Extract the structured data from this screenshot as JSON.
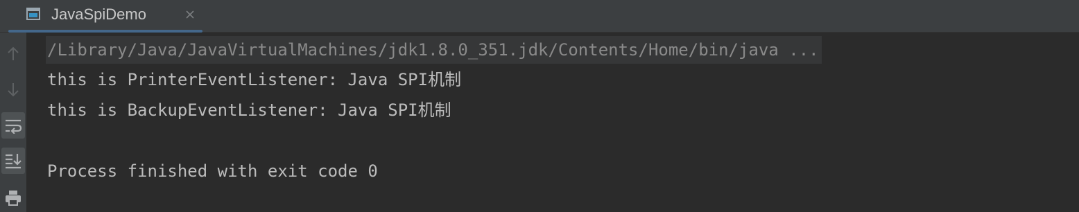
{
  "tab": {
    "title": "JavaSpiDemo",
    "icon": "console-window-icon",
    "close_icon": "close-icon"
  },
  "toolbar": {
    "buttons": [
      {
        "icon": "arrow-up-icon",
        "label": "Up the stack trace"
      },
      {
        "icon": "arrow-down-icon",
        "label": "Down the stack trace"
      },
      {
        "icon": "soft-wrap-icon",
        "label": "Soft-wrap",
        "active": true
      },
      {
        "icon": "scroll-to-end-icon",
        "label": "Scroll to the end",
        "active": true
      },
      {
        "icon": "print-icon",
        "label": "Print"
      }
    ]
  },
  "console": {
    "command_line": "/Library/Java/JavaVirtualMachines/jdk1.8.0_351.jdk/Contents/Home/bin/java ...",
    "output": [
      "this is PrinterEventListener: Java SPI机制",
      "this is BackupEventListener: Java SPI机制",
      "",
      "Process finished with exit code 0"
    ]
  },
  "colors": {
    "background": "#2b2b2b",
    "toolbar": "#3c3f41",
    "text": "#bbbbbb",
    "command_text": "#8a8a8a",
    "tab_accent": "#4a88c7"
  }
}
